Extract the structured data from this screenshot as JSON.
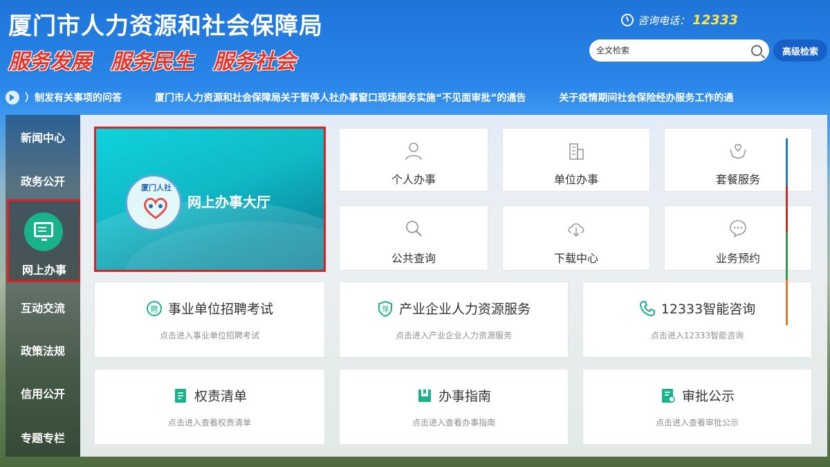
{
  "header": {
    "title": "厦门市人力资源和社会保障局",
    "slogans": [
      "服务发展",
      "服务民生",
      "服务社会"
    ],
    "hotline_label": "咨询电话：",
    "hotline_number": "12333",
    "search_placeholder": "全文检索",
    "advanced_search": "高级检索"
  },
  "ticker": {
    "items": [
      "）制发有关事项的问答",
      "厦门市人力资源和社会保障局关于暂停人社办事窗口现场服务实施“不见面审批”的通告",
      "关于疫情期间社会保险经办服务工作的通"
    ]
  },
  "nav": {
    "items": [
      "新闻中心",
      "政务公开",
      "网上办事",
      "互动交流",
      "政策法规",
      "信用公开",
      "专题专栏"
    ],
    "active": "网上办事"
  },
  "banner": {
    "title": "网上办事大厅",
    "logo_text": "厦门人社"
  },
  "tiles": [
    {
      "label": "个人办事",
      "icon": "person-icon"
    },
    {
      "label": "单位办事",
      "icon": "building-icon"
    },
    {
      "label": "套餐服务",
      "icon": "hands-heart-icon"
    },
    {
      "label": "公共查询",
      "icon": "search-icon"
    },
    {
      "label": "下载中心",
      "icon": "cloud-download-icon"
    },
    {
      "label": "业务预约",
      "icon": "chat-bubble-icon"
    }
  ],
  "services": [
    {
      "title": "事业单位招聘考试",
      "sub": "点击进入事业单位招聘考试",
      "icon": "recruit-icon",
      "badge": "聘"
    },
    {
      "title": "产业企业人力资源服务",
      "sub": "点击进入产业企业人力资源服务",
      "icon": "shield-icon",
      "badge": "保"
    },
    {
      "title": "12333智能咨询",
      "sub": "点击进入12333智能咨询",
      "icon": "phone-icon",
      "badge": ""
    },
    {
      "title": "权责清单",
      "sub": "点击进入查看权责清单",
      "icon": "list-doc-icon",
      "badge": ""
    },
    {
      "title": "办事指南",
      "sub": "点击进入查看办事指南",
      "icon": "book-icon",
      "badge": ""
    },
    {
      "title": "审批公示",
      "sub": "点击进入查看审批公示",
      "icon": "approval-doc-icon",
      "badge": ""
    }
  ],
  "colors": {
    "accent": "#18b28d",
    "highlight": "#e02020",
    "brand_blue": "#1661c7"
  }
}
